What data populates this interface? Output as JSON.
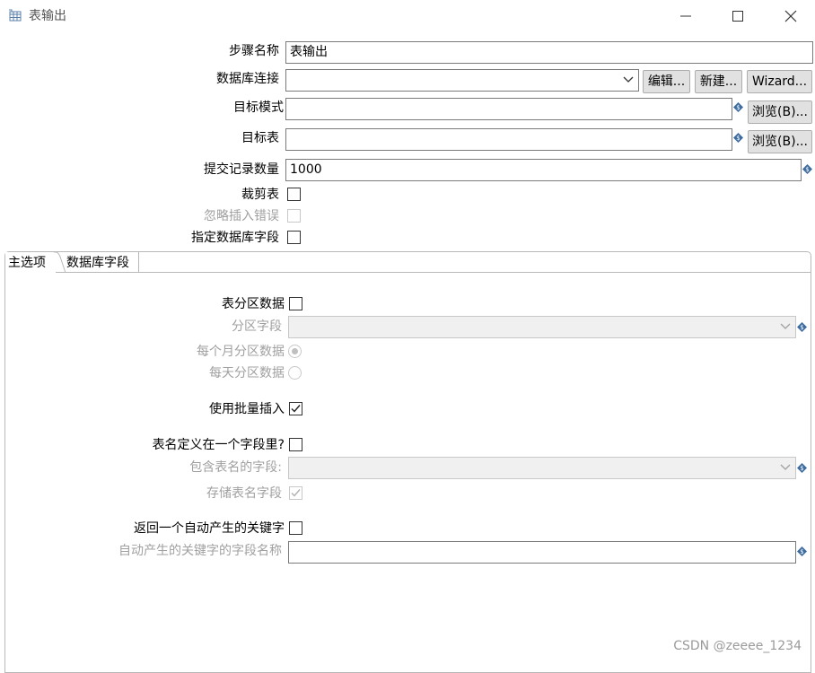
{
  "window": {
    "title": "表输出"
  },
  "form": {
    "step_name_label": "步骤名称",
    "step_name_value": "表输出",
    "db_connection_label": "数据库连接",
    "db_connection_value": "",
    "edit_label": "编辑...",
    "new_label": "新建...",
    "wizard_label": "Wizard...",
    "target_schema_label": "目标模式",
    "target_schema_value": "",
    "browse_label": "浏览(B)...",
    "target_table_label": "目标表",
    "target_table_value": "",
    "commit_size_label": "提交记录数量",
    "commit_size_value": "1000",
    "truncate_label": "裁剪表",
    "ignore_errors_label": "忽略插入错误",
    "specify_fields_label": "指定数据库字段"
  },
  "tabs": [
    {
      "label": "主选项",
      "active": true
    },
    {
      "label": "数据库字段",
      "active": false
    }
  ],
  "main": {
    "partition_data_label": "表分区数据",
    "partition_field_label": "分区字段",
    "partition_field_value": "",
    "monthly_label": "每个月分区数据",
    "daily_label": "每天分区数据",
    "batch_insert_label": "使用批量插入",
    "batch_insert_checked": true,
    "table_in_field_label": "表名定义在一个字段里?",
    "table_name_field_label": "包含表名的字段:",
    "table_name_field_value": "",
    "store_table_name_label": "存储表名字段",
    "return_key_label": "返回一个自动产生的关键字",
    "key_field_label": "自动产生的关键字的字段名称",
    "key_field_value": ""
  },
  "watermark": "CSDN @zeeee_1234"
}
